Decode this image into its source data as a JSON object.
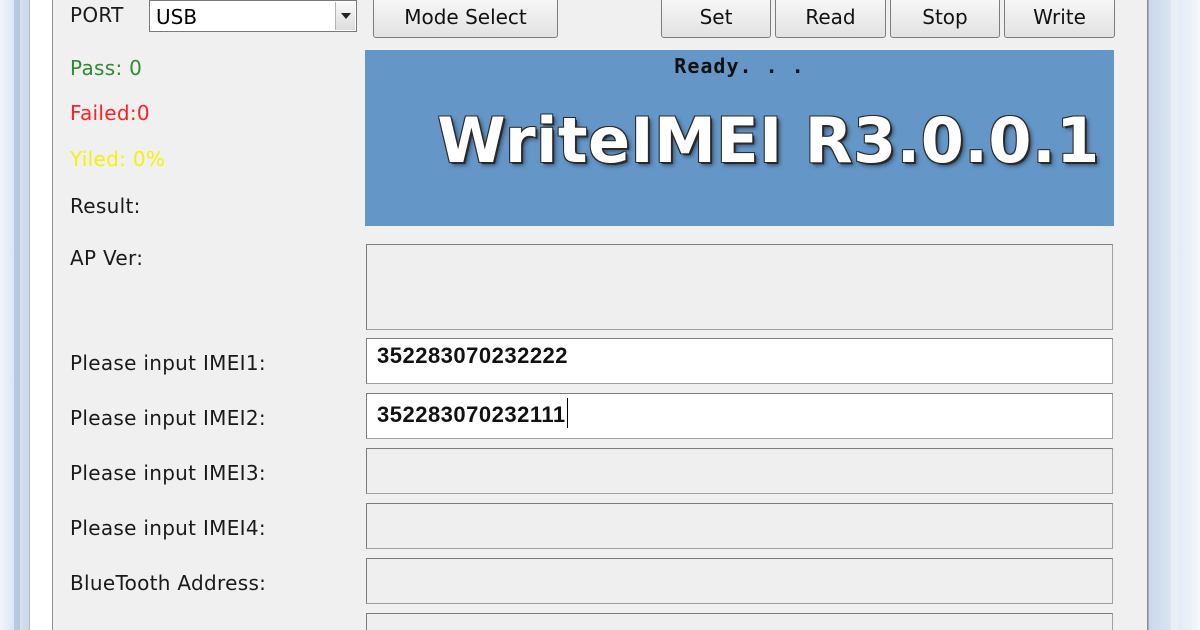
{
  "top": {
    "port_label": "PORT",
    "port_value": "USB",
    "mode_select": "Mode Select",
    "set": "Set",
    "read": "Read",
    "stop": "Stop",
    "write": "Write"
  },
  "stats": {
    "pass": "Pass:  0",
    "failed": "Failed:0",
    "yield": "Yiled:  0%",
    "result": "Result:"
  },
  "banner": {
    "status": "Ready. . .",
    "title": "WriteIMEI R3.0.0.1"
  },
  "fields": {
    "ap_ver_label": "AP Ver:",
    "imei1_label": "Please input IMEI1:",
    "imei1_value": "352283070232222",
    "imei2_label": "Please input IMEI2:",
    "imei2_value": "352283070232111",
    "imei3_label": "Please input IMEI3:",
    "imei4_label": "Please input IMEI4:",
    "bt_label": "BlueTooth Address:"
  },
  "colors": {
    "banner_bg": "#6496c8",
    "pass": "#2e8b2e",
    "failed": "#ff2020",
    "yield": "#f2f20a"
  }
}
